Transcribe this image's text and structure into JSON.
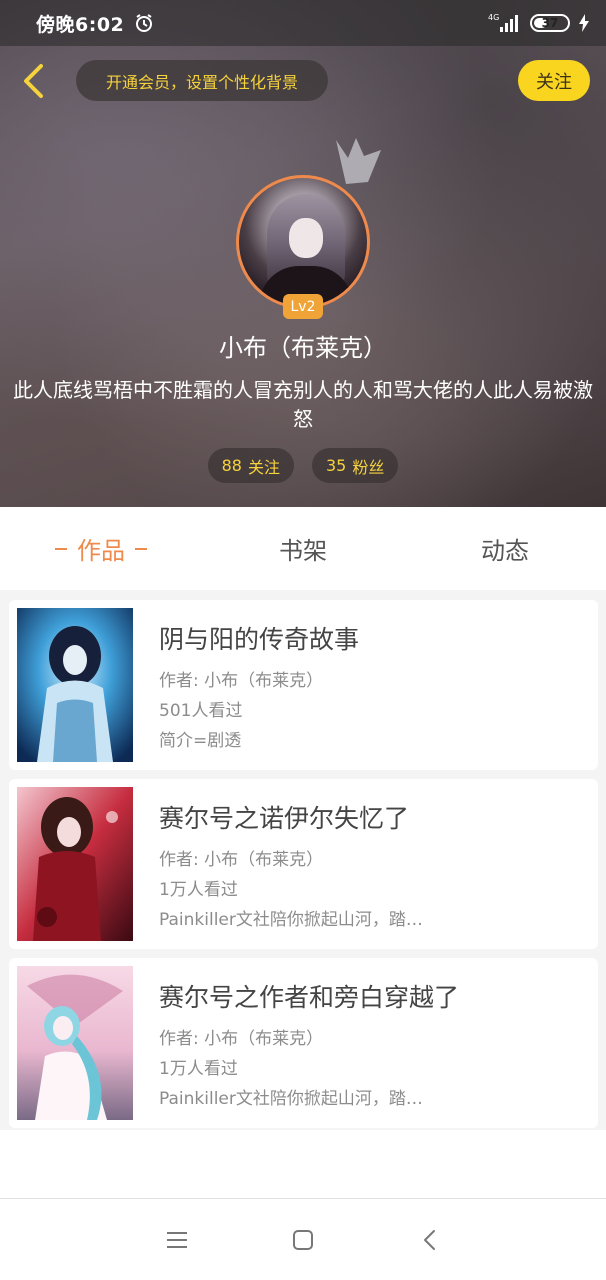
{
  "status_bar": {
    "time": "傍晚6:02",
    "battery": "37",
    "network": "4G"
  },
  "header": {
    "vip_prompt": "开通会员，设置个性化背景",
    "follow_label": "关注"
  },
  "profile": {
    "level": "Lv2",
    "username": "小布（布莱克）",
    "bio": "此人底线骂梧中不胜霜的人冒充别人的人和骂大佬的人此人易被激怒",
    "following_count": "88",
    "following_label": "关注",
    "followers_count": "35",
    "followers_label": "粉丝"
  },
  "tabs": [
    {
      "label": "作品",
      "active": true
    },
    {
      "label": "书架",
      "active": false
    },
    {
      "label": "动态",
      "active": false
    }
  ],
  "works": [
    {
      "title": "阴与阳的传奇故事",
      "author": "作者: 小布（布莱克）",
      "views": "501人看过",
      "summary": "简介=剧透"
    },
    {
      "title": "赛尔号之诺伊尔失忆了",
      "author": "作者: 小布（布莱克）",
      "views": "1万人看过",
      "summary": "Painkiller文社陪你掀起山河，踏…"
    },
    {
      "title": "赛尔号之作者和旁白穿越了",
      "author": "作者: 小布（布莱克）",
      "views": "1万人看过",
      "summary": "Painkiller文社陪你掀起山河，踏…"
    }
  ],
  "colors": {
    "accent_orange": "#ef8a4d",
    "accent_yellow": "#f9d51f",
    "stat_text": "#f6d23c"
  }
}
